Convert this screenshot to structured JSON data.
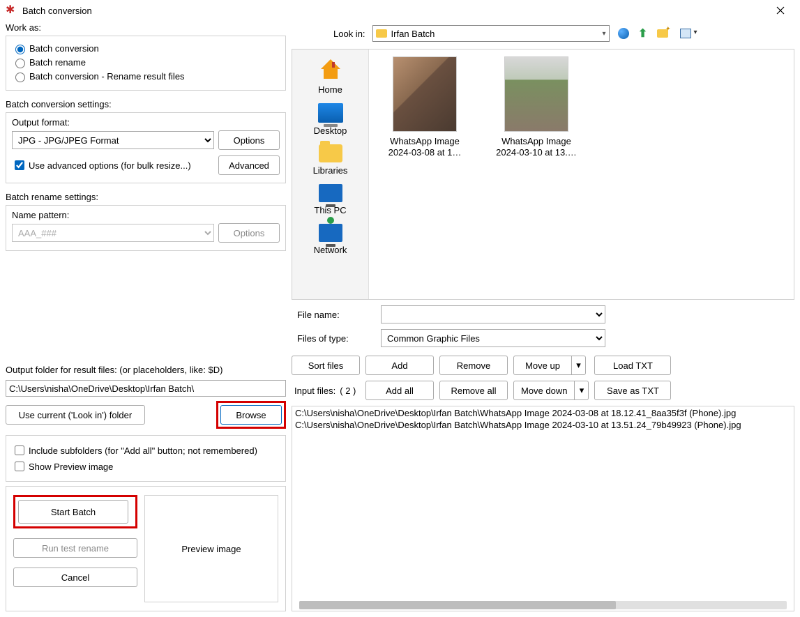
{
  "window": {
    "title": "Batch conversion"
  },
  "work_as": {
    "label": "Work as:",
    "options": [
      {
        "label": "Batch conversion",
        "checked": true
      },
      {
        "label": "Batch rename",
        "checked": false
      },
      {
        "label": "Batch conversion - Rename result files",
        "checked": false
      }
    ]
  },
  "conv_settings": {
    "label": "Batch conversion settings:",
    "output_format_label": "Output format:",
    "output_format_value": "JPG - JPG/JPEG Format",
    "options_btn": "Options",
    "advanced_chk": "Use advanced options (for bulk resize...)",
    "advanced_btn": "Advanced"
  },
  "rename_settings": {
    "label": "Batch rename settings:",
    "name_pattern_label": "Name pattern:",
    "name_pattern_placeholder": "AAA_###",
    "options_btn": "Options"
  },
  "output": {
    "label": "Output folder for result files: (or placeholders, like: $D)",
    "path": "C:\\Users\\nisha\\OneDrive\\Desktop\\Irfan Batch\\",
    "use_current_btn": "Use current ('Look in') folder",
    "browse_btn": "Browse"
  },
  "bottom_checks": {
    "include_sub": "Include subfolders (for \"Add all\" button; not remembered)",
    "show_preview": "Show Preview image"
  },
  "actions": {
    "start": "Start Batch",
    "run_test": "Run test rename",
    "cancel": "Cancel",
    "preview_label": "Preview image"
  },
  "browser": {
    "look_in_label": "Look in:",
    "look_in_value": "Irfan Batch",
    "places": [
      "Home",
      "Desktop",
      "Libraries",
      "This PC",
      "Network"
    ],
    "files": [
      {
        "name": "WhatsApp Image 2024-03-08 at 1…"
      },
      {
        "name": "WhatsApp Image 2024-03-10 at 13.…"
      }
    ],
    "file_name_label": "File name:",
    "file_name_value": "",
    "files_of_type_label": "Files of type:",
    "files_of_type_value": "Common Graphic Files"
  },
  "mid": {
    "sort": "Sort files",
    "add": "Add",
    "remove": "Remove",
    "move_up": "Move up",
    "load_txt": "Load TXT",
    "add_all": "Add all",
    "remove_all": "Remove all",
    "move_down": "Move down",
    "save_txt": "Save as TXT",
    "input_files_label": "Input files:",
    "input_files_count": "( 2 )"
  },
  "input_list": [
    "C:\\Users\\nisha\\OneDrive\\Desktop\\Irfan Batch\\WhatsApp Image 2024-03-08 at 18.12.41_8aa35f3f (Phone).jpg",
    "C:\\Users\\nisha\\OneDrive\\Desktop\\Irfan Batch\\WhatsApp Image 2024-03-10 at 13.51.24_79b49923 (Phone).jpg"
  ]
}
